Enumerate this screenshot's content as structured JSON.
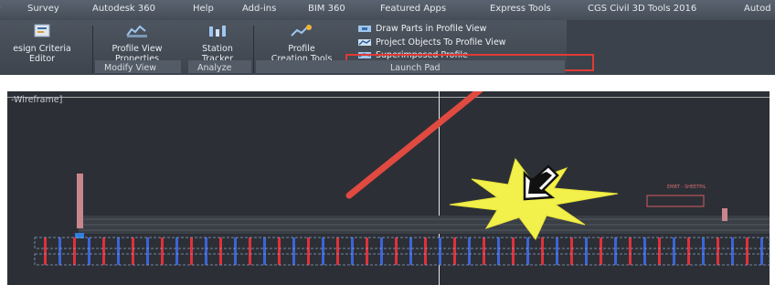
{
  "menu_tabs": [
    "Survey",
    "Autodesk 360",
    "Help",
    "Add-ins",
    "BIM 360",
    "Featured Apps",
    "Express Tools",
    "CGS Civil 3D Tools 2016",
    "Autod"
  ],
  "ribbon": {
    "design_criteria": {
      "line1": "esign Criteria",
      "line2": "Editor"
    },
    "profile_view_props": {
      "line1": "Profile View",
      "line2": "Properties"
    },
    "station_tracker": {
      "line1": "Station",
      "line2": "Tracker"
    },
    "profile_creation": {
      "line1": "Profile",
      "line2": "Creation Tools"
    },
    "launch_pad_items": [
      "Draw Parts in Profile View",
      "Project Objects To Profile View",
      "Superimposed Profile"
    ],
    "panels": {
      "modify_view": "Modify View",
      "analyze": "Analyze",
      "launch_pad": "Launch Pad"
    }
  },
  "viewport": {
    "label": "-Wireframe]"
  },
  "annotation": {
    "small_label": "EMBT - SHEETPIL"
  },
  "colors": {
    "ribbon": "#444b55",
    "canvas": "#2c3036",
    "highlight": "#e03a35",
    "arrow": "#e04a40",
    "burst": "#f2f04a"
  },
  "icons": [
    "design-criteria-icon",
    "profile-view-properties-icon",
    "station-tracker-icon",
    "profile-creation-icon",
    "project-objects-icon",
    "cursor-icon",
    "arrow-icon",
    "starburst-icon"
  ]
}
